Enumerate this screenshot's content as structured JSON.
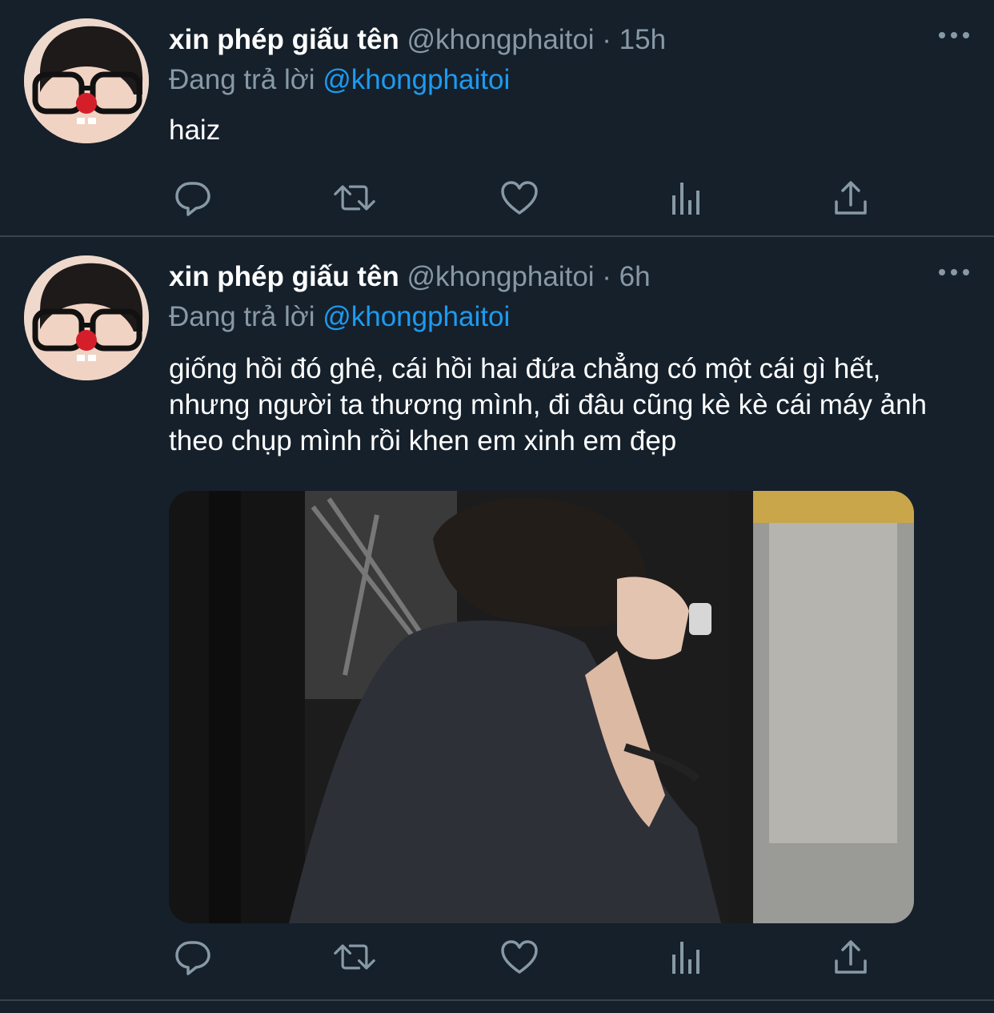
{
  "colors": {
    "background": "#15202b",
    "divider": "#38444d",
    "secondary_text": "#8899a6",
    "mention": "#1d9bf0",
    "icon": "#8899a6"
  },
  "tweets": [
    {
      "display_name": "xin phép giấu tên",
      "handle": "@khongphaitoi",
      "dot": " · ",
      "time": "15h",
      "replying_prefix": "Đang trả lời ",
      "replying_to": "@khongphaitoi",
      "text": "haiz",
      "icons": [
        "avatar",
        "more-icon",
        "reply-icon",
        "retweet-icon",
        "like-icon",
        "views-icon",
        "share-icon"
      ]
    },
    {
      "display_name": "xin phép giấu tên",
      "handle": "@khongphaitoi",
      "dot": " · ",
      "time": "6h",
      "replying_prefix": "Đang trả lời ",
      "replying_to": "@khongphaitoi",
      "text": "giống hồi đó ghê, cái hồi hai đứa chẳng có một cái gì hết, nhưng người ta thương mình, đi đâu cũng kè kè cái máy ảnh theo chụp mình rồi khen em xinh em đẹp",
      "icons": [
        "avatar",
        "more-icon",
        "photo",
        "reply-icon",
        "retweet-icon",
        "like-icon",
        "views-icon",
        "share-icon"
      ]
    }
  ]
}
